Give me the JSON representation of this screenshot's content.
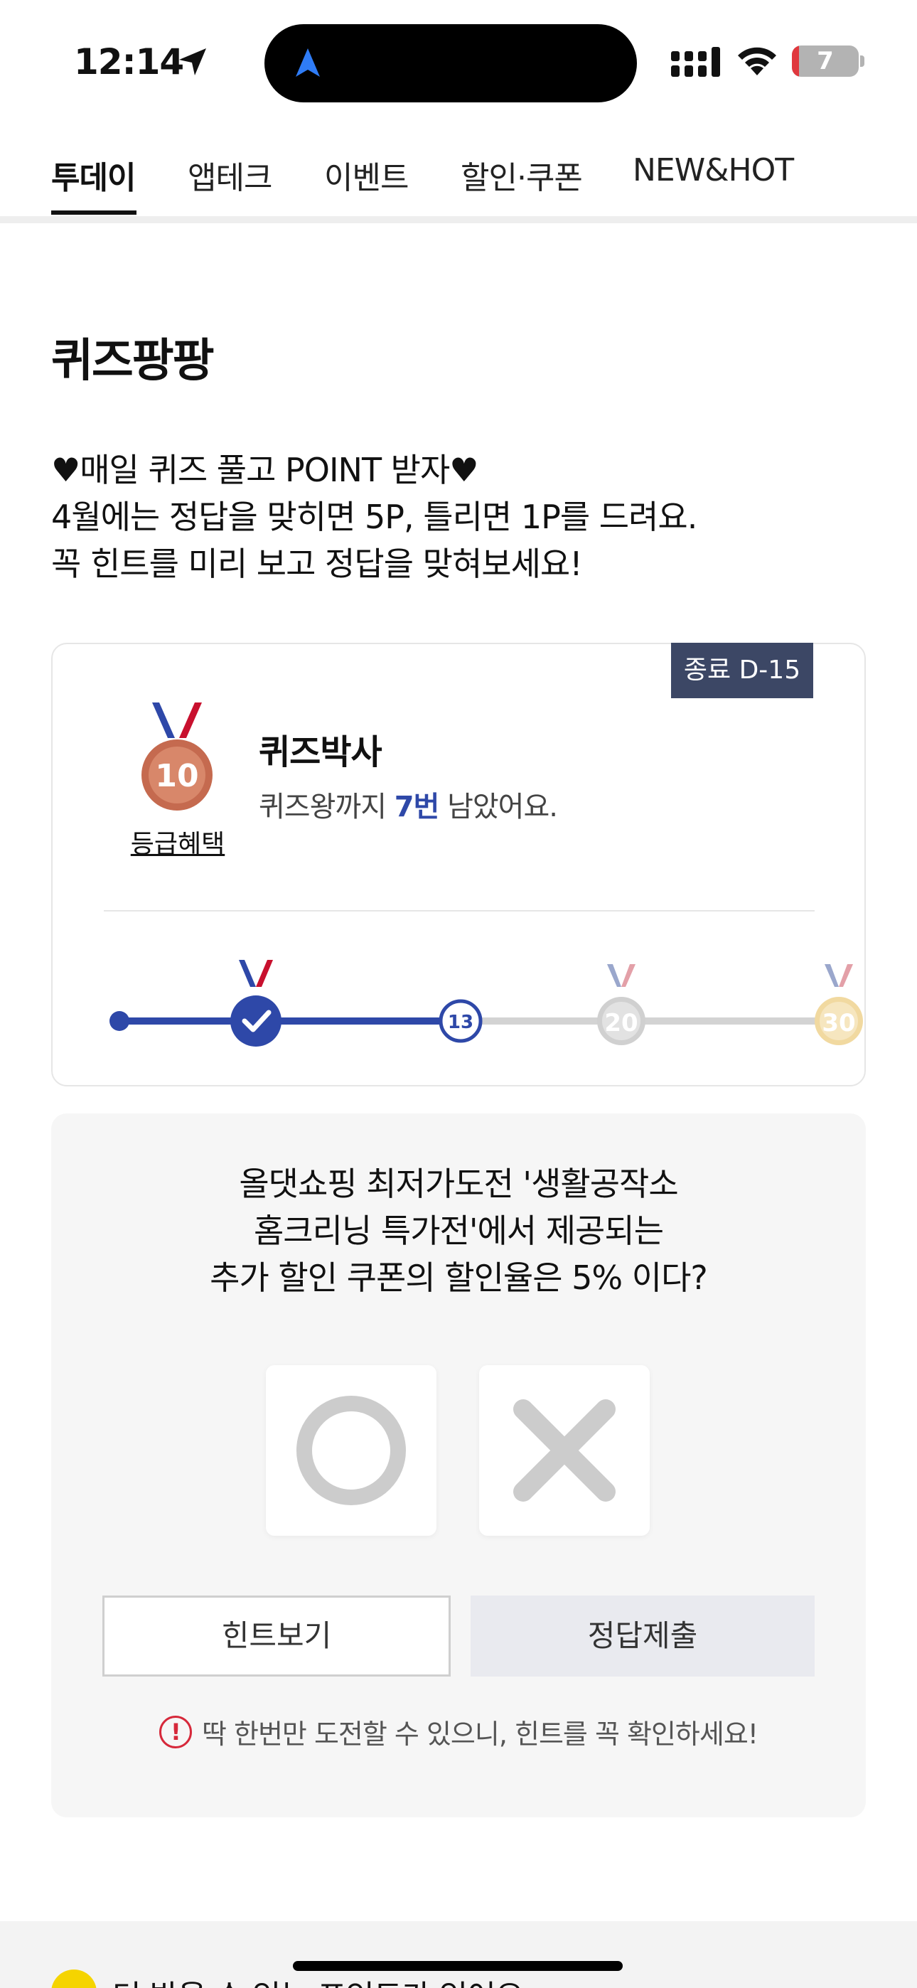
{
  "status_bar": {
    "time": "12:14",
    "battery_level": "7"
  },
  "tabs": [
    {
      "label": "투데이",
      "active": true
    },
    {
      "label": "앱테크",
      "active": false
    },
    {
      "label": "이벤트",
      "active": false
    },
    {
      "label": "할인·쿠폰",
      "active": false
    },
    {
      "label": "NEW&HOT",
      "active": false
    }
  ],
  "page": {
    "title": "퀴즈팡팡",
    "intro_lines": [
      "♥매일 퀴즈 풀고 POINT 받자♥",
      "4월에는 정답을 맞히면 5P, 틀리면 1P를 드려요.",
      "꼭 힌트를 미리 보고 정답을 맞혀보세요!"
    ]
  },
  "level_card": {
    "deadline": "종료 D-15",
    "medal_number": "10",
    "grade_benefit": "등급혜택",
    "level_name": "퀴즈박사",
    "remain_prefix": "퀴즈왕까지 ",
    "remain_count": "7번",
    "remain_suffix": " 남았어요.",
    "progress": {
      "current": 13,
      "milestones": [
        "10",
        "20",
        "30"
      ]
    }
  },
  "quiz": {
    "question_lines": [
      "올댓쇼핑 최저가도전 '생활공작소",
      "홈크리닝 특가전'에서 제공되는",
      "추가 할인 쿠폰의 할인율은 5% 이다?"
    ],
    "hint_button": "힌트보기",
    "submit_button": "정답제출",
    "notice_icon": "!",
    "notice": "딱 한번만 도전할 수 있으니, 힌트를 꼭 확인하세요!"
  },
  "bottom": {
    "points_text": "더 받을 수 있는 포인트가 있어요",
    "chevron": "›"
  },
  "colors": {
    "accent": "#2e48a8",
    "badge": "#3c4765",
    "bronze": "#c56a4f",
    "silver": "#d0d0d0",
    "gold": "#f1d9a0",
    "notice_red": "#d6283a"
  }
}
